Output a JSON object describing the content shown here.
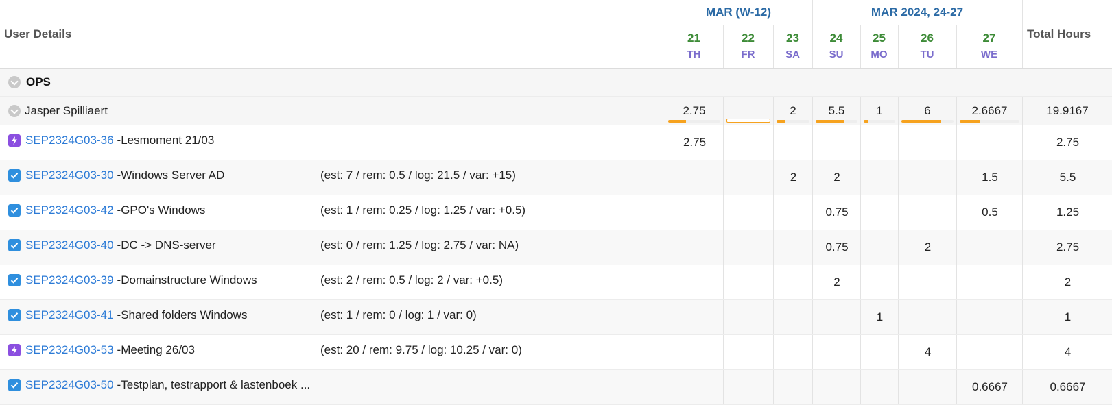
{
  "header": {
    "user_details": "User Details",
    "total_hours": "Total Hours",
    "week1": "MAR (W-12)",
    "week2": "MAR 2024, 24-27",
    "days": [
      {
        "num": "21",
        "dow": "TH"
      },
      {
        "num": "22",
        "dow": "FR"
      },
      {
        "num": "23",
        "dow": "SA"
      },
      {
        "num": "24",
        "dow": "SU"
      },
      {
        "num": "25",
        "dow": "MO"
      },
      {
        "num": "26",
        "dow": "TU"
      },
      {
        "num": "27",
        "dow": "WE"
      }
    ]
  },
  "group": {
    "name": "OPS"
  },
  "user": {
    "name": "Jasper Spilliaert",
    "days": [
      "2.75",
      "",
      "2",
      "5.5",
      "1",
      "6",
      "2.6667"
    ],
    "total": "19.9167",
    "progress": [
      0.34,
      0.0,
      0.25,
      0.69,
      0.13,
      0.75,
      0.33
    ]
  },
  "tasks": [
    {
      "key": "SEP2324G03-36",
      "name": "-Lesmoment 21/03",
      "stats": "",
      "icon": "bolt-icon",
      "days": [
        "2.75",
        "",
        "",
        "",
        "",
        "",
        ""
      ],
      "total": "2.75"
    },
    {
      "key": "SEP2324G03-30",
      "name": "-Windows Server AD",
      "stats": "(est: 7 / rem: 0.5 / log: 21.5 / var: +15)",
      "icon": "checkbox-icon",
      "days": [
        "",
        "",
        "2",
        "2",
        "",
        "",
        "1.5"
      ],
      "total": "5.5"
    },
    {
      "key": "SEP2324G03-42",
      "name": "-GPO's Windows",
      "stats": "(est: 1 / rem: 0.25 / log: 1.25 / var: +0.5)",
      "icon": "checkbox-icon",
      "days": [
        "",
        "",
        "",
        "0.75",
        "",
        "",
        "0.5"
      ],
      "total": "1.25"
    },
    {
      "key": "SEP2324G03-40",
      "name": "-DC -> DNS-server",
      "stats": "(est: 0 / rem: 1.25 / log: 2.75 / var: NA)",
      "icon": "checkbox-icon",
      "days": [
        "",
        "",
        "",
        "0.75",
        "",
        "2",
        ""
      ],
      "total": "2.75"
    },
    {
      "key": "SEP2324G03-39",
      "name": "-Domainstructure Windows",
      "stats": "(est: 2 / rem: 0.5 / log: 2 / var: +0.5)",
      "icon": "checkbox-icon",
      "days": [
        "",
        "",
        "",
        "2",
        "",
        "",
        ""
      ],
      "total": "2"
    },
    {
      "key": "SEP2324G03-41",
      "name": "-Shared folders Windows",
      "stats": "(est: 1 / rem: 0 / log: 1 / var: 0)",
      "icon": "checkbox-icon",
      "days": [
        "",
        "",
        "",
        "",
        "1",
        "",
        ""
      ],
      "total": "1"
    },
    {
      "key": "SEP2324G03-53",
      "name": "-Meeting 26/03",
      "stats": "(est: 20 / rem: 9.75 / log: 10.25 / var: 0)",
      "icon": "bolt-icon",
      "days": [
        "",
        "",
        "",
        "",
        "",
        "4",
        ""
      ],
      "total": "4"
    },
    {
      "key": "SEP2324G03-50",
      "name": "-Testplan, testrapport & lastenboek ...",
      "stats": "",
      "icon": "checkbox-icon",
      "days": [
        "",
        "",
        "",
        "",
        "",
        "",
        "0.6667"
      ],
      "total": "0.6667"
    }
  ],
  "colors": {
    "link": "#2b7ad6",
    "week_header": "#2b6aa5",
    "day_number": "#3d8b37",
    "day_of_week": "#7a6ccc",
    "bar": "#f6a21e",
    "bolt_icon": "#8b4fe0",
    "check_icon": "#2f8fde"
  }
}
